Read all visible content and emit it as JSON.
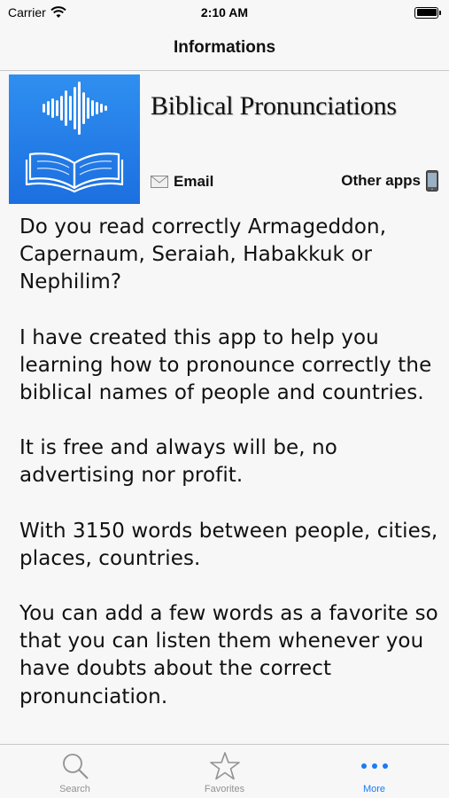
{
  "status_bar": {
    "carrier": "Carrier",
    "time": "2:10 AM"
  },
  "nav": {
    "title": "Informations"
  },
  "header": {
    "app_title": "Biblical Pronunciations",
    "email_label": "Email",
    "other_apps_label": "Other apps",
    "icons": [
      "app-icon",
      "mail-icon",
      "phone-icon"
    ]
  },
  "description": {
    "paragraphs": [
      "Do you read correctly Armageddon, Capernaum, Seraiah, Habakkuk or Nephilim?",
      "I have created this app to help you learning how to pronounce correctly the biblical names of people and countries.",
      "It is free and always will be, no advertising nor profit.",
      "With 3150 words between people, cities, places, countries.",
      "You can add a few words as a favorite so that you can listen them whenever you have doubts about the correct pronunciation."
    ]
  },
  "tabs": [
    {
      "label": "Search",
      "icon": "search-icon",
      "active": false
    },
    {
      "label": "Favorites",
      "icon": "star-icon",
      "active": false
    },
    {
      "label": "More",
      "icon": "more-icon",
      "active": true
    }
  ],
  "colors": {
    "accent": "#1a7cf5",
    "inactive": "#929292",
    "icon_bg": "#2f8ff0"
  }
}
